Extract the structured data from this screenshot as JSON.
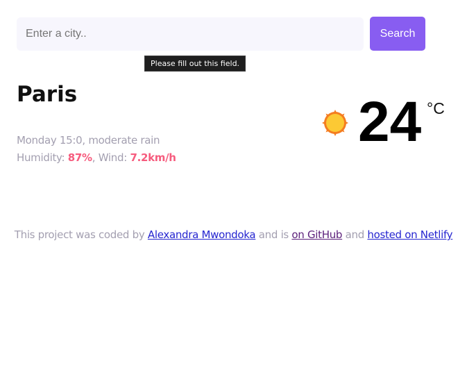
{
  "search": {
    "placeholder": "Enter a city..",
    "value": "",
    "button_label": "Search",
    "validation_message": "Please fill out this field."
  },
  "weather": {
    "city": "Paris",
    "datetime": "Monday 15:0",
    "description": "moderate rain",
    "humidity_label": "Humidity:",
    "humidity_value": "87%",
    "wind_label": "Wind:",
    "wind_value": "7.2km/h",
    "temperature": "24",
    "unit": "°C",
    "icon": "sun-icon"
  },
  "footer": {
    "prefix": "This project was coded by",
    "author_link": "Alexandra Mwondoka",
    "middle": "and is",
    "github_link": "on GitHub",
    "and": "and",
    "netlify_link": "hosted on Netlify"
  },
  "colors": {
    "accent": "#885df1",
    "highlight": "#f65c7e",
    "muted_text": "#a39fb0",
    "input_bg": "#f7f6fd",
    "sun_fill": "#fcc934",
    "sun_rays": "#f47d20"
  }
}
